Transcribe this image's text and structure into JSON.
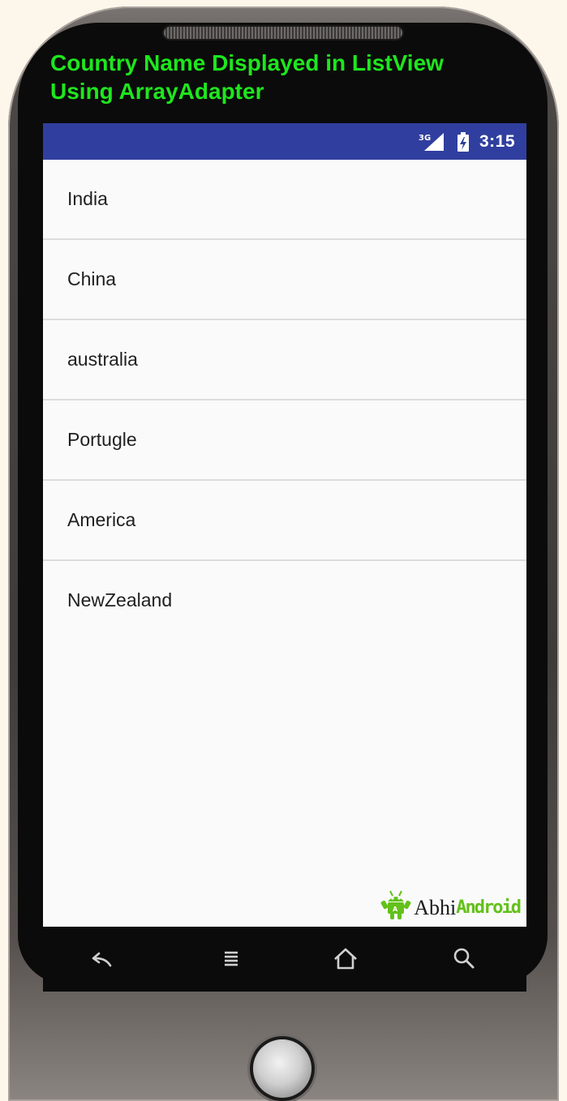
{
  "overlay": {
    "title_line1": "Country Name Displayed in ListView",
    "title_line2": "Using ArrayAdapter",
    "color": "#1ee61e"
  },
  "status_bar": {
    "network_label": "3G",
    "time": "3:15",
    "background": "#303f9f",
    "icons": [
      "signal-icon",
      "battery-icon"
    ]
  },
  "list": {
    "items": [
      "India",
      "China",
      "australia",
      "Portugle",
      "America",
      "NewZealand"
    ]
  },
  "watermark": {
    "part1": "Abhi",
    "part2": "Android",
    "accent": "#63c11a"
  },
  "nav_bar": {
    "buttons": [
      "back-icon",
      "menu-icon",
      "home-icon",
      "search-icon"
    ]
  }
}
